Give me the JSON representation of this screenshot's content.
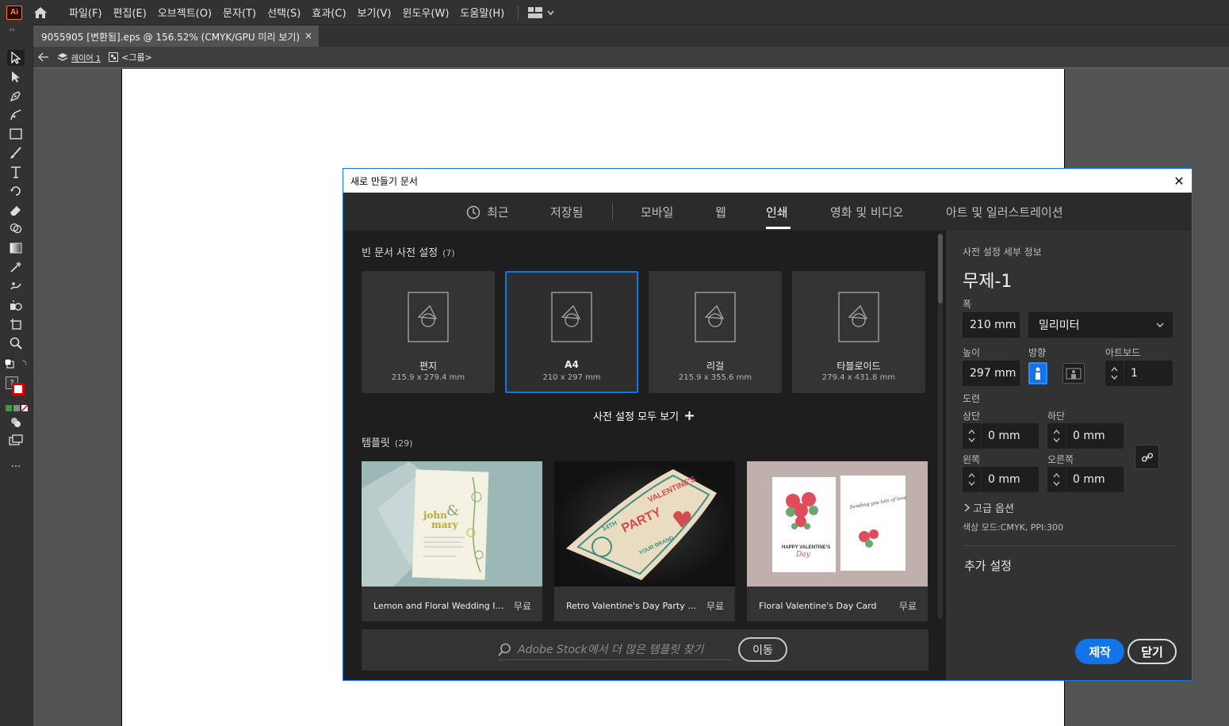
{
  "menubar": {
    "logo": "Ai",
    "items": [
      "파일(F)",
      "편집(E)",
      "오브젝트(O)",
      "문자(T)",
      "선택(S)",
      "효과(C)",
      "보기(V)",
      "윈도우(W)",
      "도움말(H)"
    ]
  },
  "document_tab": {
    "title": "9055905 [변환됨].eps @ 156.52% (CMYK/GPU 미리 보기)",
    "close": "×"
  },
  "breadcrumb": {
    "layer": "레이어 1",
    "group": "<그룹>"
  },
  "toolbar": {
    "fill_stroke_hint": "?",
    "more": "..."
  },
  "dialog": {
    "title": "새로 만들기 문서",
    "close": "✕",
    "tabs": [
      "최근",
      "저장됨",
      "모바일",
      "웹",
      "인쇄",
      "영화 및 비디오",
      "아트 및 일러스트레이션"
    ],
    "active_tab": "인쇄",
    "blank_presets": {
      "title": "빈 문서 사전 설정",
      "count": "(7)",
      "items": [
        {
          "name": "편지",
          "size": "215.9 x 279.4 mm"
        },
        {
          "name": "A4",
          "size": "210 x 297 mm"
        },
        {
          "name": "리걸",
          "size": "215.9 x 355.6 mm"
        },
        {
          "name": "타블로이드",
          "size": "279.4 x 431.8 mm"
        }
      ],
      "selected": "A4",
      "view_all": "사전 설정 모두 보기"
    },
    "templates": {
      "title": "템플릿",
      "count": "(29)",
      "items": [
        {
          "name": "Lemon and Floral Wedding Invit...",
          "price": "무료",
          "art_text": [
            "john",
            "&",
            "mary"
          ]
        },
        {
          "name": "Retro Valentine's Day Party Flyer",
          "price": "무료",
          "art_text": [
            "VALENTINE'S",
            "14TH",
            "PARTY",
            "YOUR BRAND"
          ]
        },
        {
          "name": "Floral Valentine's Day Card",
          "price": "무료",
          "art_text": [
            "HAPPY VALENTINE'S",
            "Day",
            "Sending you lots of love"
          ]
        }
      ]
    },
    "stock": {
      "placeholder": "Adobe Stock에서 더 많은 템플릿 찾기",
      "go": "이동"
    },
    "details": {
      "header": "사전 설정 세부 정보",
      "doc_name": "무제-1",
      "width_label": "폭",
      "width": "210 mm",
      "units": "밀리미터",
      "height_label": "높이",
      "height": "297 mm",
      "orientation_label": "방향",
      "orientation": "portrait",
      "artboards_label": "아트보드",
      "artboards": "1",
      "bleed_label": "도련",
      "bleed_top_label": "상단",
      "bleed_top": "0 mm",
      "bleed_bottom_label": "하단",
      "bleed_bottom": "0 mm",
      "bleed_left_label": "왼쪽",
      "bleed_left": "0 mm",
      "bleed_right_label": "오른쪽",
      "bleed_right": "0 mm",
      "advanced": "고급 옵션",
      "color_mode": "색상 모드:CMYK, PPI:300",
      "more_settings": "추가 설정",
      "create": "제작",
      "close": "닫기"
    }
  },
  "colors": {
    "accent": "#1473e6",
    "app_bg": "#535353",
    "panel_bg": "#323232"
  }
}
